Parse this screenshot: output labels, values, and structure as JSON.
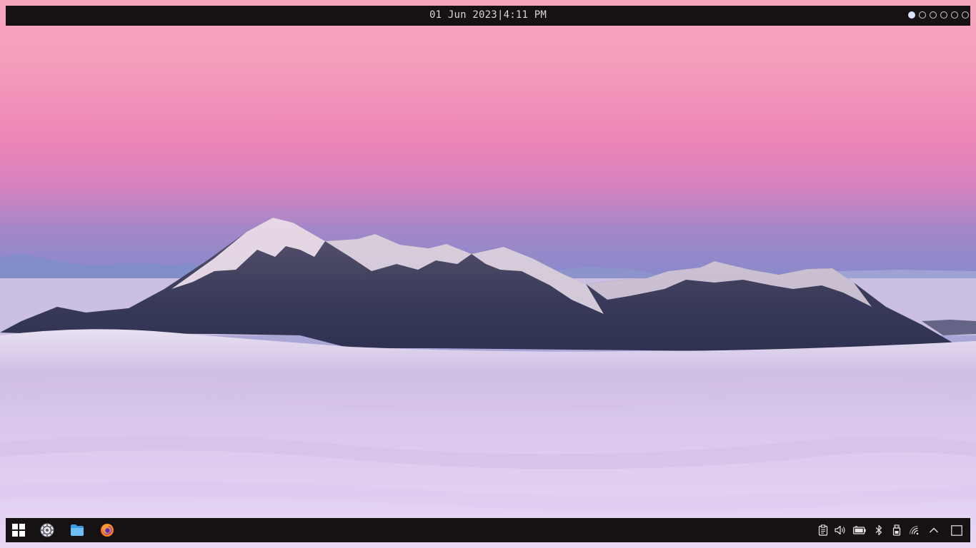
{
  "topbar": {
    "date": "01 Jun 2023",
    "separator": "|",
    "time": "4:11 PM",
    "workspaces": [
      {
        "active": true
      },
      {
        "active": false
      },
      {
        "active": false
      },
      {
        "active": false
      },
      {
        "active": false
      },
      {
        "active": false
      }
    ]
  },
  "taskbar": {
    "start_icon": "windows-logo-icon",
    "pinned_apps": [
      {
        "icon": "settings-app-icon"
      },
      {
        "icon": "file-manager-icon"
      },
      {
        "icon": "firefox-icon"
      }
    ],
    "tray": [
      {
        "icon": "clipboard-icon"
      },
      {
        "icon": "volume-icon"
      },
      {
        "icon": "battery-icon"
      },
      {
        "icon": "bluetooth-icon"
      },
      {
        "icon": "usb-drive-icon"
      },
      {
        "icon": "wifi-icon"
      },
      {
        "icon": "chevron-up-icon"
      },
      {
        "icon": "show-desktop-icon"
      }
    ]
  },
  "colors": {
    "bar_bg": "#161214",
    "sky_top": "#f6a3bd",
    "sky_mid": "#ef86b6",
    "sky_low": "#8a88cc",
    "cloud": "#dcc6ec",
    "mountain": "#3b3f5e",
    "snow": "#f2e8f2"
  }
}
